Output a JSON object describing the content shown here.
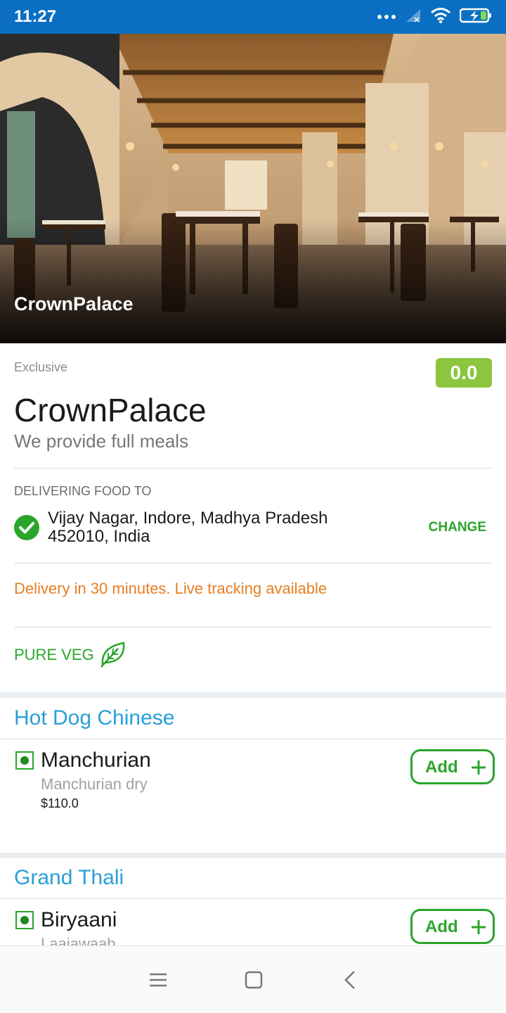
{
  "status_bar": {
    "time": "11:27"
  },
  "hero": {
    "title": "CrownPalace"
  },
  "restaurant": {
    "badge": "Exclusive",
    "rating": "0.0",
    "name": "CrownPalace",
    "description": "We provide full meals"
  },
  "delivery": {
    "label": "DELIVERING FOOD TO",
    "address_line1": "Vijay Nagar, Indore, Madhya Pradesh",
    "address_line2": "452010, India",
    "change_label": "CHANGE",
    "info": "Delivery in 30 minutes. Live tracking available"
  },
  "pure_veg": {
    "label": "PURE VEG"
  },
  "categories": [
    {
      "title": "Hot Dog Chinese",
      "items": [
        {
          "name": "Manchurian",
          "description": "Manchurian dry",
          "price": "$110.0",
          "add_label": "Add"
        }
      ]
    },
    {
      "title": "Grand Thali",
      "items": [
        {
          "name": "Biryaani",
          "description": "Laajawaab",
          "add_label": "Add"
        }
      ]
    }
  ],
  "colors": {
    "status_bar": "#0a6fc2",
    "rating_bg": "#8cc63f",
    "accent_green": "#2aa52a",
    "category_blue": "#2a9fd8",
    "delivery_orange": "#e67e22"
  },
  "icons": [
    "signal-icon",
    "wifi-icon",
    "battery-icon",
    "check-icon",
    "leaf-icon",
    "veg-marker-icon",
    "plus-icon",
    "menu-icon",
    "home-icon",
    "back-icon"
  ]
}
